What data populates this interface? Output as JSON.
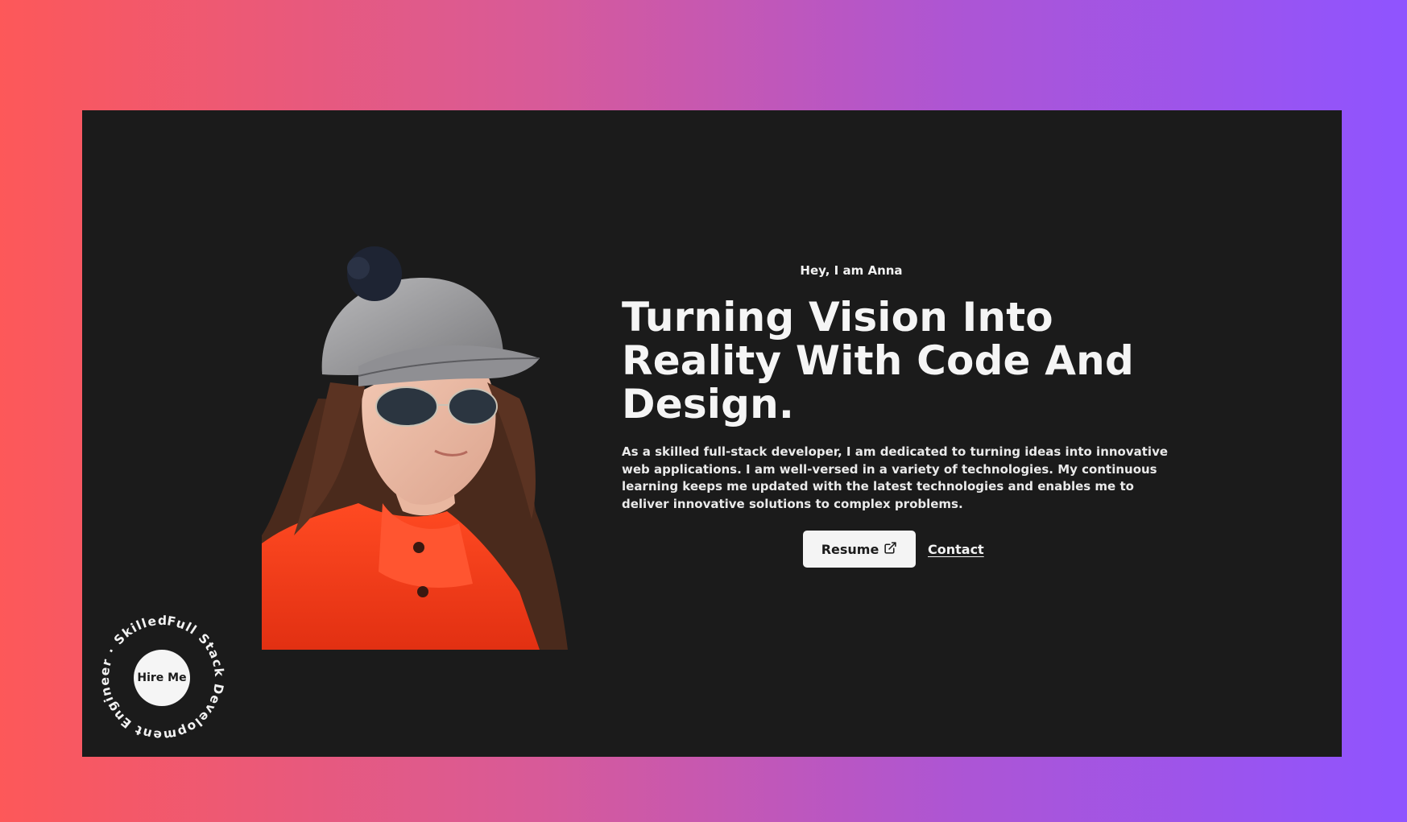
{
  "hero": {
    "greeting": "Hey, I am Anna",
    "headline": "Turning Vision Into Reality With Code And Design.",
    "bio": "As a skilled full-stack developer, I am dedicated to turning ideas into innovative web applications. I am well-versed in a variety of technologies. My continuous learning keeps me updated with the latest technologies and enables me to deliver innovative solutions to complex problems.",
    "resume_label": "Resume",
    "contact_label": "Contact"
  },
  "badge": {
    "ring_text": "Full Stack Development Engineer · Skilled Full Stack · Development Engineer · Skilled",
    "button_label": "Hire Me"
  },
  "icons": {
    "resume": "external-link-icon"
  },
  "colors": {
    "background_left": "#fd5859",
    "background_right": "#8f54ff",
    "panel": "#1b1b1b",
    "text": "#f5f5f5"
  }
}
